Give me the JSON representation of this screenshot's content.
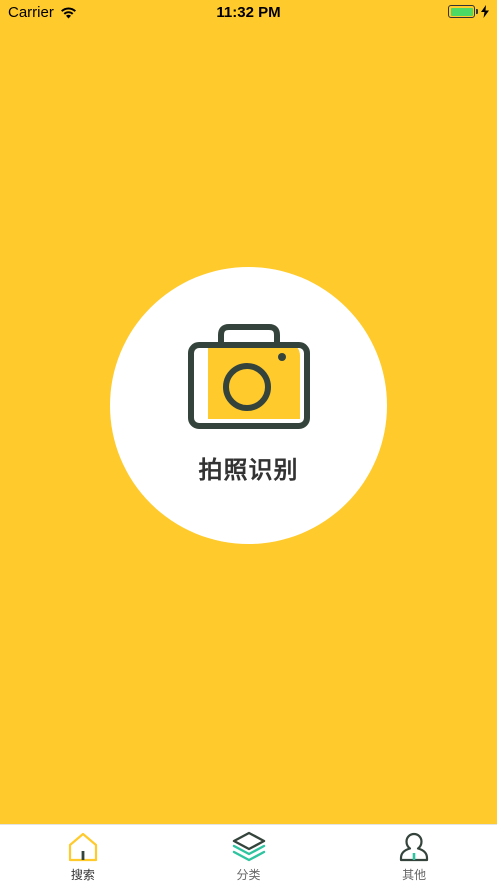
{
  "status_bar": {
    "carrier": "Carrier",
    "time": "11:32 PM",
    "battery_color": "#4CD964"
  },
  "main": {
    "background_color": "#FFCA2C",
    "action_label": "拍照识别",
    "action_icon": "camera-icon"
  },
  "tab_bar": {
    "items": [
      {
        "label": "搜索",
        "icon": "home-icon",
        "active": true
      },
      {
        "label": "分类",
        "icon": "layers-icon",
        "active": false
      },
      {
        "label": "其他",
        "icon": "person-icon",
        "active": false
      }
    ],
    "accent_color": "#FFCA2C",
    "secondary_accent": "#2EC4A0"
  }
}
